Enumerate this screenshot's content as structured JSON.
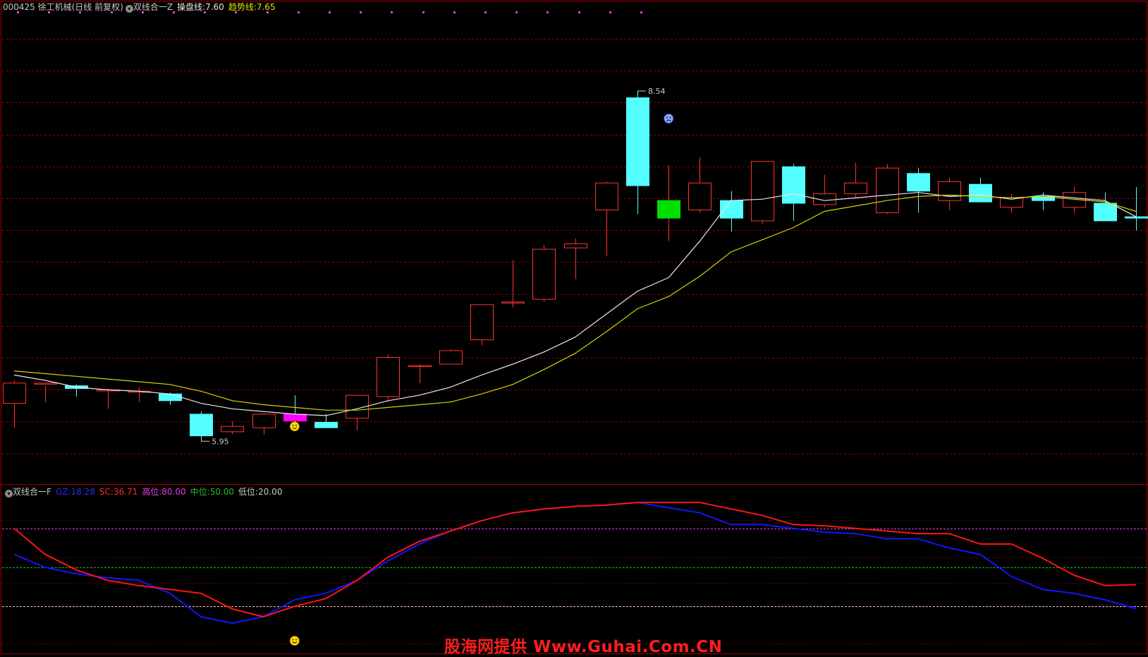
{
  "header_top": {
    "stock": "000425 徐工机械(日线 前复权)",
    "indicator": "双线合一Z",
    "line1_label": "操盘线:",
    "line1_value": "7.60",
    "line2_label": "趋势线:",
    "line2_value": "7.65"
  },
  "header_bottom": {
    "indicator": "双线合一F",
    "gz_label": "GZ:",
    "gz_value": "18.28",
    "sc_label": "SC:",
    "sc_value": "36.71",
    "high_label": "高位:",
    "high_value": "80.00",
    "mid_label": "中位:",
    "mid_value": "50.00",
    "low_label": "低位:",
    "low_value": "20.00"
  },
  "watermark": "股海网提供 Www.Guhai.Com.CN",
  "colors": {
    "up": "#ff3232",
    "down": "#54ffff",
    "operate_line": "#e8e8e8",
    "trend_line": "#d4d400",
    "gz": "#1414ff",
    "sc": "#ff1414",
    "high": "#e040e0",
    "mid": "#20c020",
    "low": "#c8c8c8",
    "grid": "#8b0000"
  },
  "chart_data": [
    {
      "type": "candlestick",
      "ylim": [
        5.8,
        8.9
      ],
      "annotations": [
        {
          "label": "8.54",
          "index": 20
        },
        {
          "label": "5.95",
          "index": 6
        }
      ],
      "candles": [
        {
          "o": 6.23,
          "h": 6.4,
          "l": 6.05,
          "c": 6.38
        },
        {
          "o": 6.38,
          "h": 6.36,
          "l": 6.24,
          "c": 6.38
        },
        {
          "o": 6.36,
          "h": 6.37,
          "l": 6.28,
          "c": 6.34
        },
        {
          "o": 6.33,
          "h": 6.34,
          "l": 6.19,
          "c": 6.33
        },
        {
          "o": 6.32,
          "h": 6.35,
          "l": 6.24,
          "c": 6.32
        },
        {
          "o": 6.3,
          "h": 6.31,
          "l": 6.22,
          "c": 6.25
        },
        {
          "o": 6.15,
          "h": 6.17,
          "l": 5.95,
          "c": 5.99
        },
        {
          "o": 6.02,
          "h": 6.1,
          "l": 6.0,
          "c": 6.06
        },
        {
          "o": 6.05,
          "h": 6.16,
          "l": 6.0,
          "c": 6.15
        },
        {
          "o": 6.15,
          "h": 6.29,
          "l": 6.07,
          "c": 6.1
        },
        {
          "o": 6.09,
          "h": 6.15,
          "l": 6.08,
          "c": 6.05
        },
        {
          "o": 6.12,
          "h": 6.16,
          "l": 6.03,
          "c": 6.29
        },
        {
          "o": 6.28,
          "h": 6.59,
          "l": 6.24,
          "c": 6.57
        },
        {
          "o": 6.51,
          "h": 6.52,
          "l": 6.38,
          "c": 6.51
        },
        {
          "o": 6.52,
          "h": 6.63,
          "l": 6.52,
          "c": 6.62
        },
        {
          "o": 6.7,
          "h": 6.94,
          "l": 6.66,
          "c": 6.96
        },
        {
          "o": 6.98,
          "h": 7.29,
          "l": 6.94,
          "c": 6.98
        },
        {
          "o": 7.0,
          "h": 7.4,
          "l": 6.98,
          "c": 7.37
        },
        {
          "o": 7.38,
          "h": 7.45,
          "l": 7.15,
          "c": 7.41
        },
        {
          "o": 7.66,
          "h": 7.87,
          "l": 7.32,
          "c": 7.86
        },
        {
          "o": 8.49,
          "h": 8.54,
          "l": 7.63,
          "c": 7.84
        },
        {
          "o": 7.6,
          "h": 7.99,
          "l": 7.43,
          "c": 7.73
        },
        {
          "o": 7.66,
          "h": 8.05,
          "l": 7.64,
          "c": 7.86
        },
        {
          "o": 7.73,
          "h": 7.8,
          "l": 7.5,
          "c": 7.6
        },
        {
          "o": 7.58,
          "h": 8.0,
          "l": 7.56,
          "c": 8.02
        },
        {
          "o": 7.98,
          "h": 8.0,
          "l": 7.58,
          "c": 7.71
        },
        {
          "o": 7.7,
          "h": 7.92,
          "l": 7.68,
          "c": 7.78
        },
        {
          "o": 7.78,
          "h": 8.01,
          "l": 7.75,
          "c": 7.86
        },
        {
          "o": 7.64,
          "h": 8.0,
          "l": 7.63,
          "c": 7.97
        },
        {
          "o": 7.93,
          "h": 7.97,
          "l": 7.64,
          "c": 7.8
        },
        {
          "o": 7.73,
          "h": 7.9,
          "l": 7.66,
          "c": 7.87
        },
        {
          "o": 7.85,
          "h": 7.9,
          "l": 7.73,
          "c": 7.72
        },
        {
          "o": 7.68,
          "h": 7.78,
          "l": 7.64,
          "c": 7.75
        },
        {
          "o": 7.76,
          "h": 7.79,
          "l": 7.66,
          "c": 7.73
        },
        {
          "o": 7.68,
          "h": 7.83,
          "l": 7.64,
          "c": 7.79
        },
        {
          "o": 7.71,
          "h": 7.79,
          "l": 7.65,
          "c": 7.58
        },
        {
          "o": 7.61,
          "h": 7.83,
          "l": 7.51,
          "c": 7.6
        }
      ],
      "series": [
        {
          "name": "操盘线",
          "values": [
            6.44,
            6.4,
            6.35,
            6.33,
            6.32,
            6.3,
            6.23,
            6.19,
            6.17,
            6.15,
            6.14,
            6.19,
            6.25,
            6.29,
            6.35,
            6.44,
            6.52,
            6.61,
            6.72,
            6.89,
            7.06,
            7.16,
            7.43,
            7.73,
            7.74,
            7.78,
            7.73,
            7.75,
            7.77,
            7.79,
            7.76,
            7.77,
            7.74,
            7.77,
            7.75,
            7.73,
            7.61
          ]
        },
        {
          "name": "趋势线",
          "values": [
            6.47,
            6.45,
            6.43,
            6.41,
            6.39,
            6.37,
            6.32,
            6.25,
            6.22,
            6.2,
            6.18,
            6.18,
            6.2,
            6.22,
            6.24,
            6.3,
            6.37,
            6.48,
            6.6,
            6.76,
            6.93,
            7.02,
            7.17,
            7.35,
            7.44,
            7.53,
            7.65,
            7.69,
            7.73,
            7.76,
            7.77,
            7.76,
            7.75,
            7.76,
            7.74,
            7.72,
            7.65
          ]
        }
      ],
      "signal_top_dots": 21,
      "signals": [
        {
          "index": 9,
          "kind": "smile"
        },
        {
          "index": 21,
          "kind": "frown"
        }
      ]
    },
    {
      "type": "line",
      "ylim": [
        0,
        100
      ],
      "hlines": [
        {
          "name": "高位",
          "value": 80
        },
        {
          "name": "中位",
          "value": 50
        },
        {
          "name": "低位",
          "value": 20
        }
      ],
      "series": [
        {
          "name": "GZ",
          "values": [
            60,
            50,
            45,
            42,
            40,
            30,
            12,
            7,
            12,
            25,
            30,
            40,
            55,
            68,
            78,
            86,
            92,
            95,
            97,
            98,
            100,
            96,
            92,
            83,
            83,
            80,
            77,
            76,
            72,
            72,
            65,
            60,
            43,
            33,
            30,
            25,
            18.28
          ]
        },
        {
          "name": "SC",
          "values": [
            80,
            60,
            48,
            40,
            36,
            33,
            30,
            18,
            12,
            20,
            26,
            40,
            58,
            70,
            78,
            86,
            92,
            95,
            97,
            98,
            100,
            100,
            100,
            95,
            90,
            83,
            82,
            80,
            78,
            76,
            76,
            68,
            68,
            57,
            44,
            36,
            36.71
          ]
        }
      ],
      "signals": [
        {
          "index": 9,
          "kind": "smile"
        }
      ]
    }
  ]
}
